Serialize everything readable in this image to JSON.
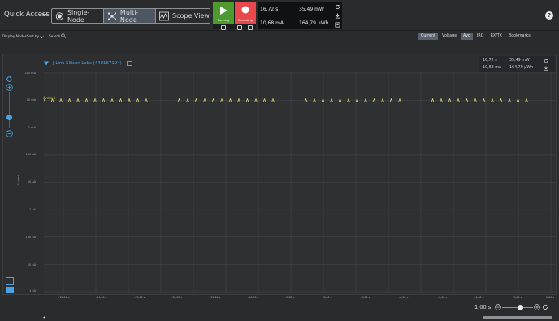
{
  "toolbar": {
    "quick_access_label": "Quick Access",
    "modes": [
      {
        "label": "Single-Node",
        "active": false
      },
      {
        "label": "Multi-Node",
        "active": true
      },
      {
        "label": "Scope View",
        "active": false
      }
    ],
    "run_label": "Running",
    "record_label": "Recording",
    "run_color": "#4d9b2e",
    "record_color": "#e8494d",
    "measurements": {
      "time": "16,72 s",
      "power": "35,49 mW",
      "current": "10,68 mA",
      "energy": "164,79 µWh"
    },
    "help_label": "?"
  },
  "subbar": {
    "display_nodes_label": "Display Nodes",
    "sort_by_label": "Sort by",
    "search_label": "Search",
    "tabs": [
      {
        "label": "Current",
        "active": true
      },
      {
        "label": "Voltage",
        "active": false
      },
      {
        "label": "Avg",
        "active": true
      },
      {
        "label": "IRQ",
        "active": false
      },
      {
        "label": "RX/TX",
        "active": false
      },
      {
        "label": "Bookmarks",
        "active": false
      }
    ]
  },
  "node": {
    "title": "J-Link Silicon Labs (440167194)",
    "summary": {
      "time": "16,72 s",
      "power": "35,49 mW",
      "current": "10,68 mA",
      "energy": "164,79 µWh"
    },
    "trace_label": "Avebr-1"
  },
  "plot": {
    "y_axis_label": "Current",
    "y_ticks": [
      "100 mA",
      "10 mA",
      "1 mA",
      "100 µA",
      "10 µA",
      "1 µA",
      "100 nA",
      "10 nA",
      "1 nA"
    ],
    "x_ticks": [
      "-15,00 s",
      "-14,00 s",
      "-13,00 s",
      "-12,00 s",
      "-11,00 s",
      "-10,00 s",
      "-9,00 s",
      "-8,00 s",
      "-7,00 s",
      "-6,00 s",
      "-5,00 s",
      "-4,00 s",
      "-3,00 s",
      "-2,00 s",
      "-1,00 s",
      "0,00 s"
    ],
    "trace_color": "#e6d36a",
    "grid_color": "#45474b"
  },
  "zoom": {
    "label": "1,00 s"
  }
}
